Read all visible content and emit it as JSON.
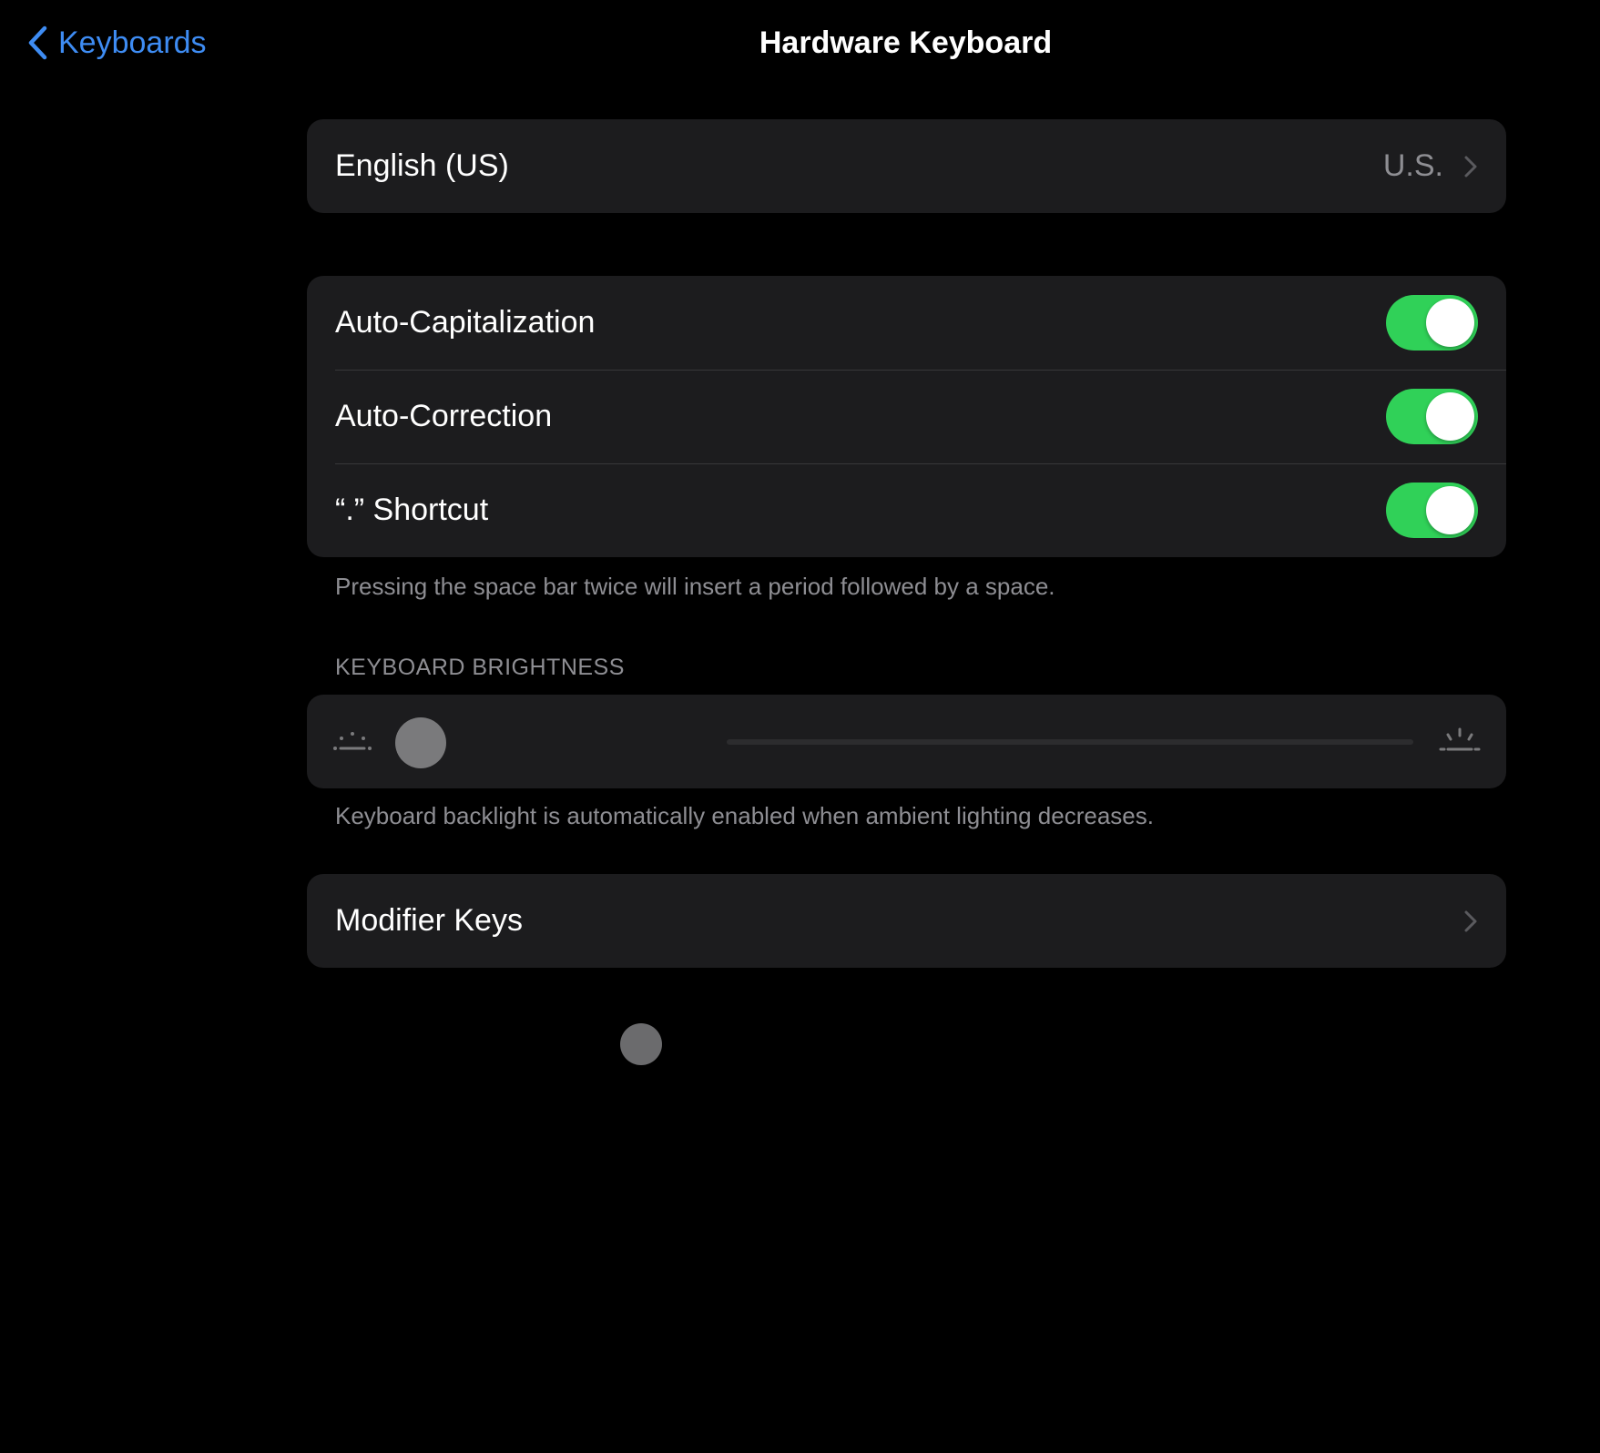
{
  "nav": {
    "back_label": "Keyboards",
    "title": "Hardware Keyboard",
    "accent_color": "#3e8cf3"
  },
  "language": {
    "label": "English (US)",
    "value": "U.S."
  },
  "toggles": [
    {
      "label": "Auto-Capitalization",
      "on": true
    },
    {
      "label": "Auto-Correction",
      "on": true
    },
    {
      "label": "“.” Shortcut",
      "on": true
    }
  ],
  "toggle_on_color": "#30d158",
  "shortcut_footer": "Pressing the space bar twice will insert a period followed by a space.",
  "brightness": {
    "header": "KEYBOARD BRIGHTNESS",
    "level": 0.0,
    "low_icon": "brightness-low-icon",
    "high_icon": "brightness-high-icon",
    "track_color": "#2c2c2e",
    "footer": "Keyboard backlight is automatically enabled when ambient lighting decreases."
  },
  "modifier_keys": {
    "label": "Modifier Keys"
  }
}
